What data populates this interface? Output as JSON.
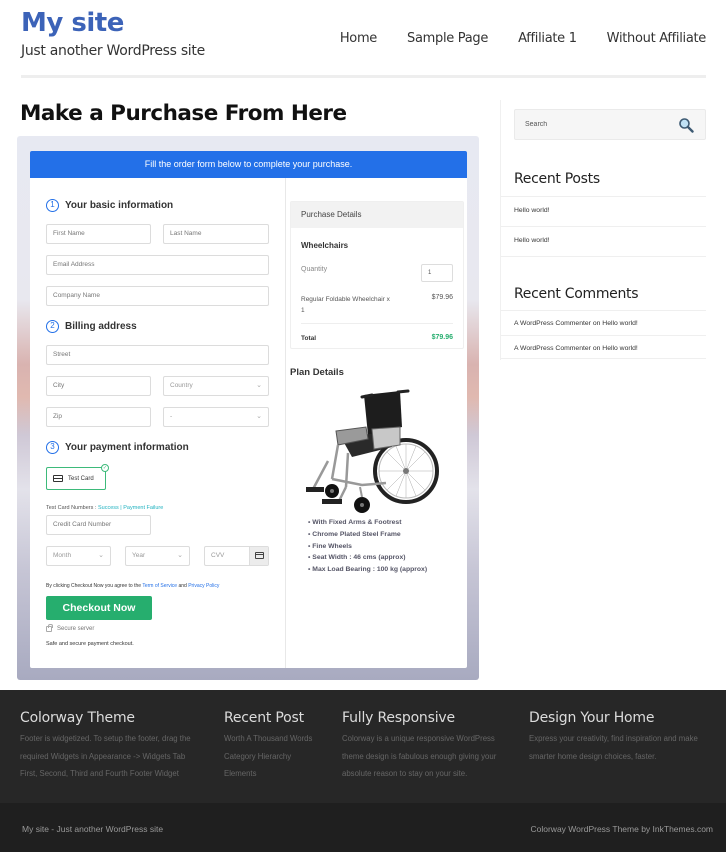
{
  "header": {
    "site_title": "My site",
    "tagline": "Just another WordPress site",
    "nav": [
      {
        "label": "Home"
      },
      {
        "label": "Sample Page"
      },
      {
        "label": "Affiliate 1"
      },
      {
        "label": "Without Affiliate"
      }
    ]
  },
  "page": {
    "title": "Make a Purchase From Here"
  },
  "checkout": {
    "banner": "Fill the order form below to complete your purchase.",
    "steps": [
      {
        "number": "1",
        "label": "Your basic information"
      },
      {
        "number": "2",
        "label": "Billing address"
      },
      {
        "number": "3",
        "label": "Your payment information"
      }
    ],
    "fields": {
      "first_name": "First Name",
      "last_name": "Last Name",
      "email": "Email Address",
      "company": "Company Name",
      "street": "Street",
      "city": "City",
      "country": "Country",
      "zip": "Zip",
      "state": "-",
      "card_number": "Credit Card Number",
      "month": "Month",
      "year": "Year",
      "cvv": "CVV"
    },
    "payment_method": "Test Card",
    "test_numbers_label": "Test Card Numbers : ",
    "test_success": "Success",
    "test_separator": " | ",
    "test_failure": "Payment Failure",
    "agree_prefix": "By clicking Checkout Now you agree to the ",
    "terms_link": "Term of Service",
    "agree_and": " and ",
    "privacy_link": "Privacy Policy",
    "checkout_button": "Checkout Now",
    "secure_label": "Secure server",
    "safe_text": "Safe and secure payment checkout."
  },
  "purchase_details": {
    "heading": "Purchase Details",
    "product": "Wheelchairs",
    "quantity_label": "Quantity",
    "quantity": "1",
    "item_name": "Regular Foldable Wheelchair x 1",
    "item_price": "$79.96",
    "total_label": "Total",
    "total": "$79.96",
    "total_color": "#26ae6e"
  },
  "plan_details": {
    "heading": "Plan Details",
    "image_alt": "wheelchair",
    "features": [
      "With Fixed Arms & Footrest",
      "Chrome Plated Steel Frame",
      "Fine Wheels",
      "Seat Width : 46 cms (approx)",
      "Max Load Bearing : 100 kg (approx)"
    ]
  },
  "sidebar": {
    "search_placeholder": "Search",
    "recent_posts_title": "Recent Posts",
    "recent_posts": [
      "Hello world!",
      "Hello world!"
    ],
    "recent_comments_title": "Recent Comments",
    "recent_comments": [
      {
        "author": "A WordPress Commenter",
        "on": " on ",
        "post": "Hello world!"
      },
      {
        "author": "A WordPress Commenter",
        "on": " on ",
        "post": "Hello world!"
      }
    ]
  },
  "footer": {
    "columns": [
      {
        "title": "Colorway Theme",
        "lines": [
          "Footer is widgetized. To setup the footer, drag the",
          "required Widgets in Appearance -> Widgets Tab",
          "First, Second, Third and Fourth Footer Widget"
        ]
      },
      {
        "title": "Recent Post",
        "lines": [
          "Worth A Thousand Words",
          "Category Hierarchy",
          "Elements"
        ]
      },
      {
        "title": "Fully Responsive",
        "lines": [
          "Colorway is a unique responsive WordPress",
          "theme design is fabulous enough giving your",
          "absolute reason to stay on your site."
        ]
      },
      {
        "title": "Design Your Home",
        "lines": [
          "Express your creativity, find inspiration and make",
          "smarter home design choices, faster."
        ]
      }
    ],
    "bottom_left": "My site - Just another WordPress site",
    "bottom_right": "Colorway WordPress Theme by InkThemes.com"
  },
  "colors": {
    "brand_blue": "#3c63b8",
    "banner_blue": "#2370e8",
    "checkout_green": "#26ae6e",
    "footer_bg": "#272727"
  }
}
